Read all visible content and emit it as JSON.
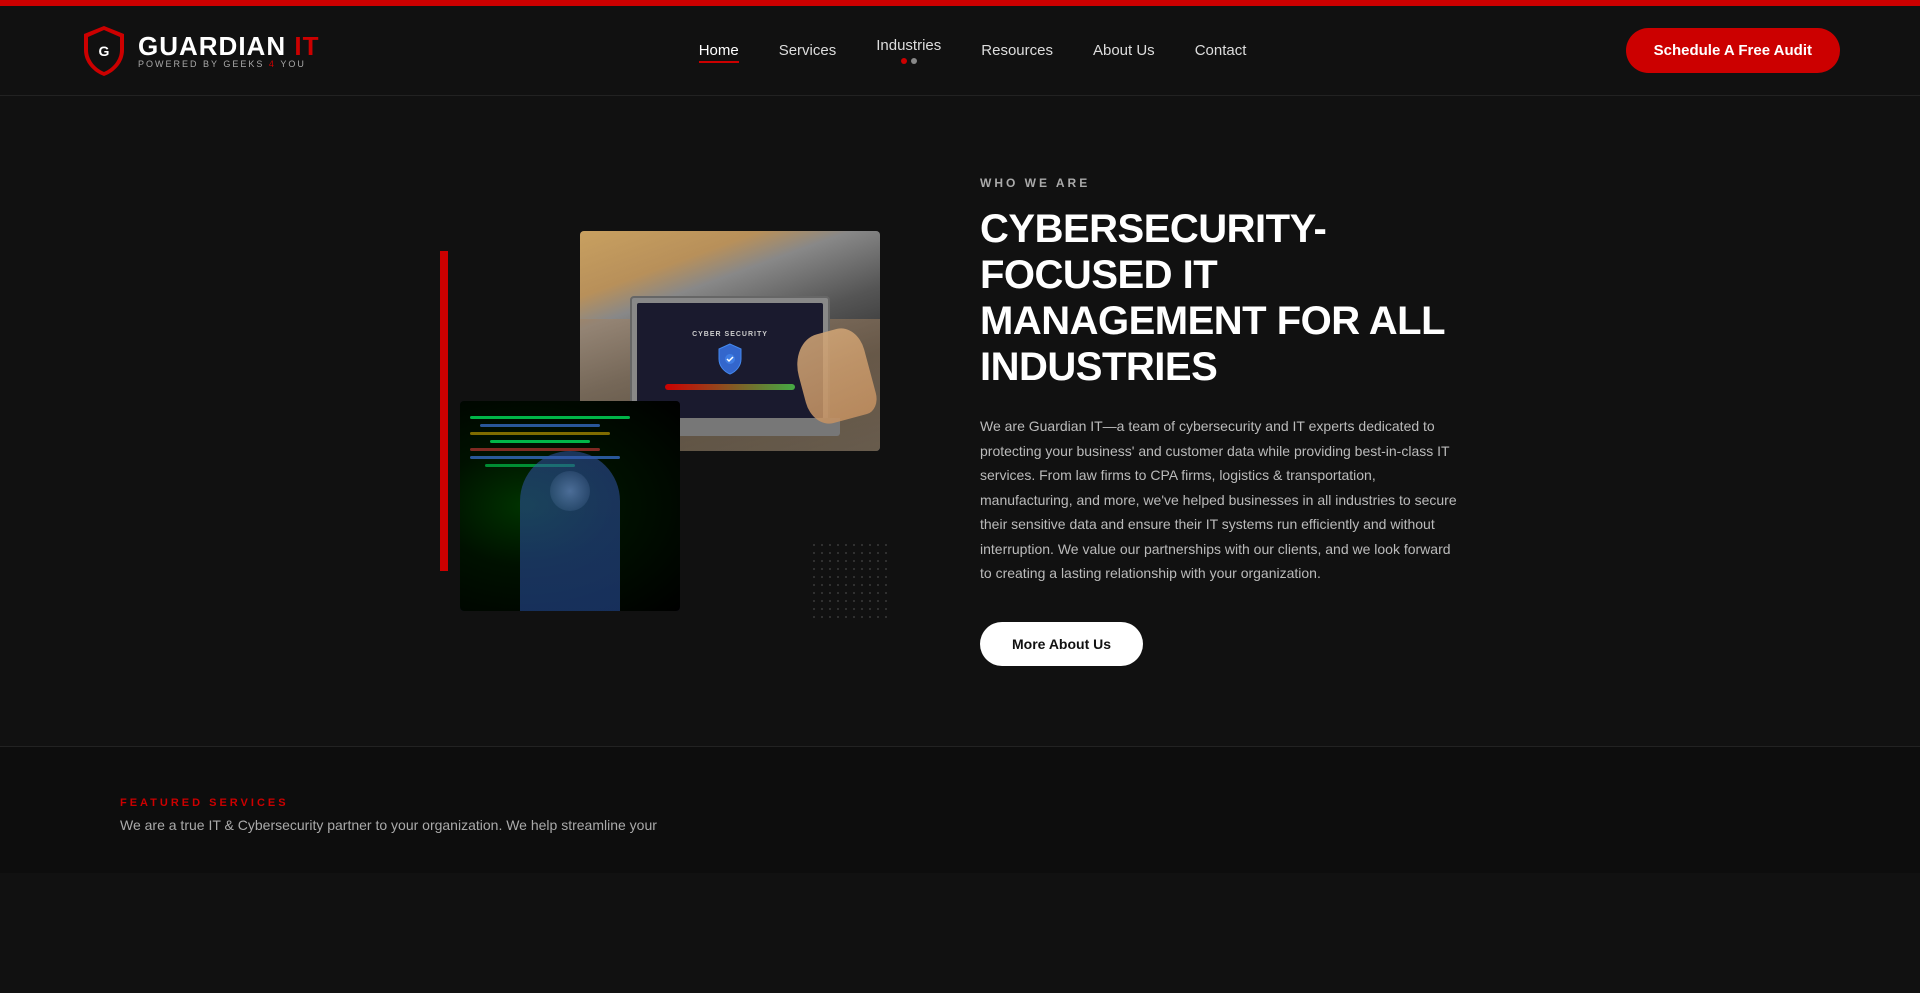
{
  "topbar": {
    "color": "#cc0000"
  },
  "navbar": {
    "logo": {
      "brand": "GUARDIAN",
      "brand_red": "IT",
      "tagline_part1": "Powered By Geeks",
      "tagline_red": "4",
      "tagline_part2": "You"
    },
    "links": [
      {
        "label": "Home",
        "active": true,
        "id": "home"
      },
      {
        "label": "Services",
        "active": false,
        "id": "services"
      },
      {
        "label": "Industries",
        "active": false,
        "id": "industries"
      },
      {
        "label": "Resources",
        "active": false,
        "id": "resources"
      },
      {
        "label": "About Us",
        "active": false,
        "id": "about-us"
      },
      {
        "label": "Contact",
        "active": false,
        "id": "contact"
      }
    ],
    "cta": {
      "label": "Schedule A Free Audit"
    }
  },
  "hero": {
    "slider_dots": [
      {
        "active": true
      },
      {
        "active": false
      }
    ]
  },
  "about_section": {
    "who_label": "WHO WE ARE",
    "title_line1": "Cybersecurity-Focused IT",
    "title_line2": "Management for All Industries",
    "description": "We are Guardian IT—a team of cybersecurity and IT experts dedicated to protecting your business' and customer data while providing best-in-class IT services. From law firms to CPA firms, logistics & transportation, manufacturing, and more, we've helped businesses in all industries to secure their sensitive data and ensure their IT systems run efficiently and without interruption. We value our partnerships with our clients, and we look forward to creating a lasting relationship with your organization.",
    "cta_label": "More About Us"
  },
  "featured_services": {
    "label": "FEATURED SERVICES",
    "description": "We are a true IT & Cybersecurity partner to your organization. We help streamline your"
  },
  "images": {
    "collage_laptop_alt": "Person typing on laptop with cybersecurity screen",
    "collage_coder_alt": "Person working with code on computer"
  }
}
